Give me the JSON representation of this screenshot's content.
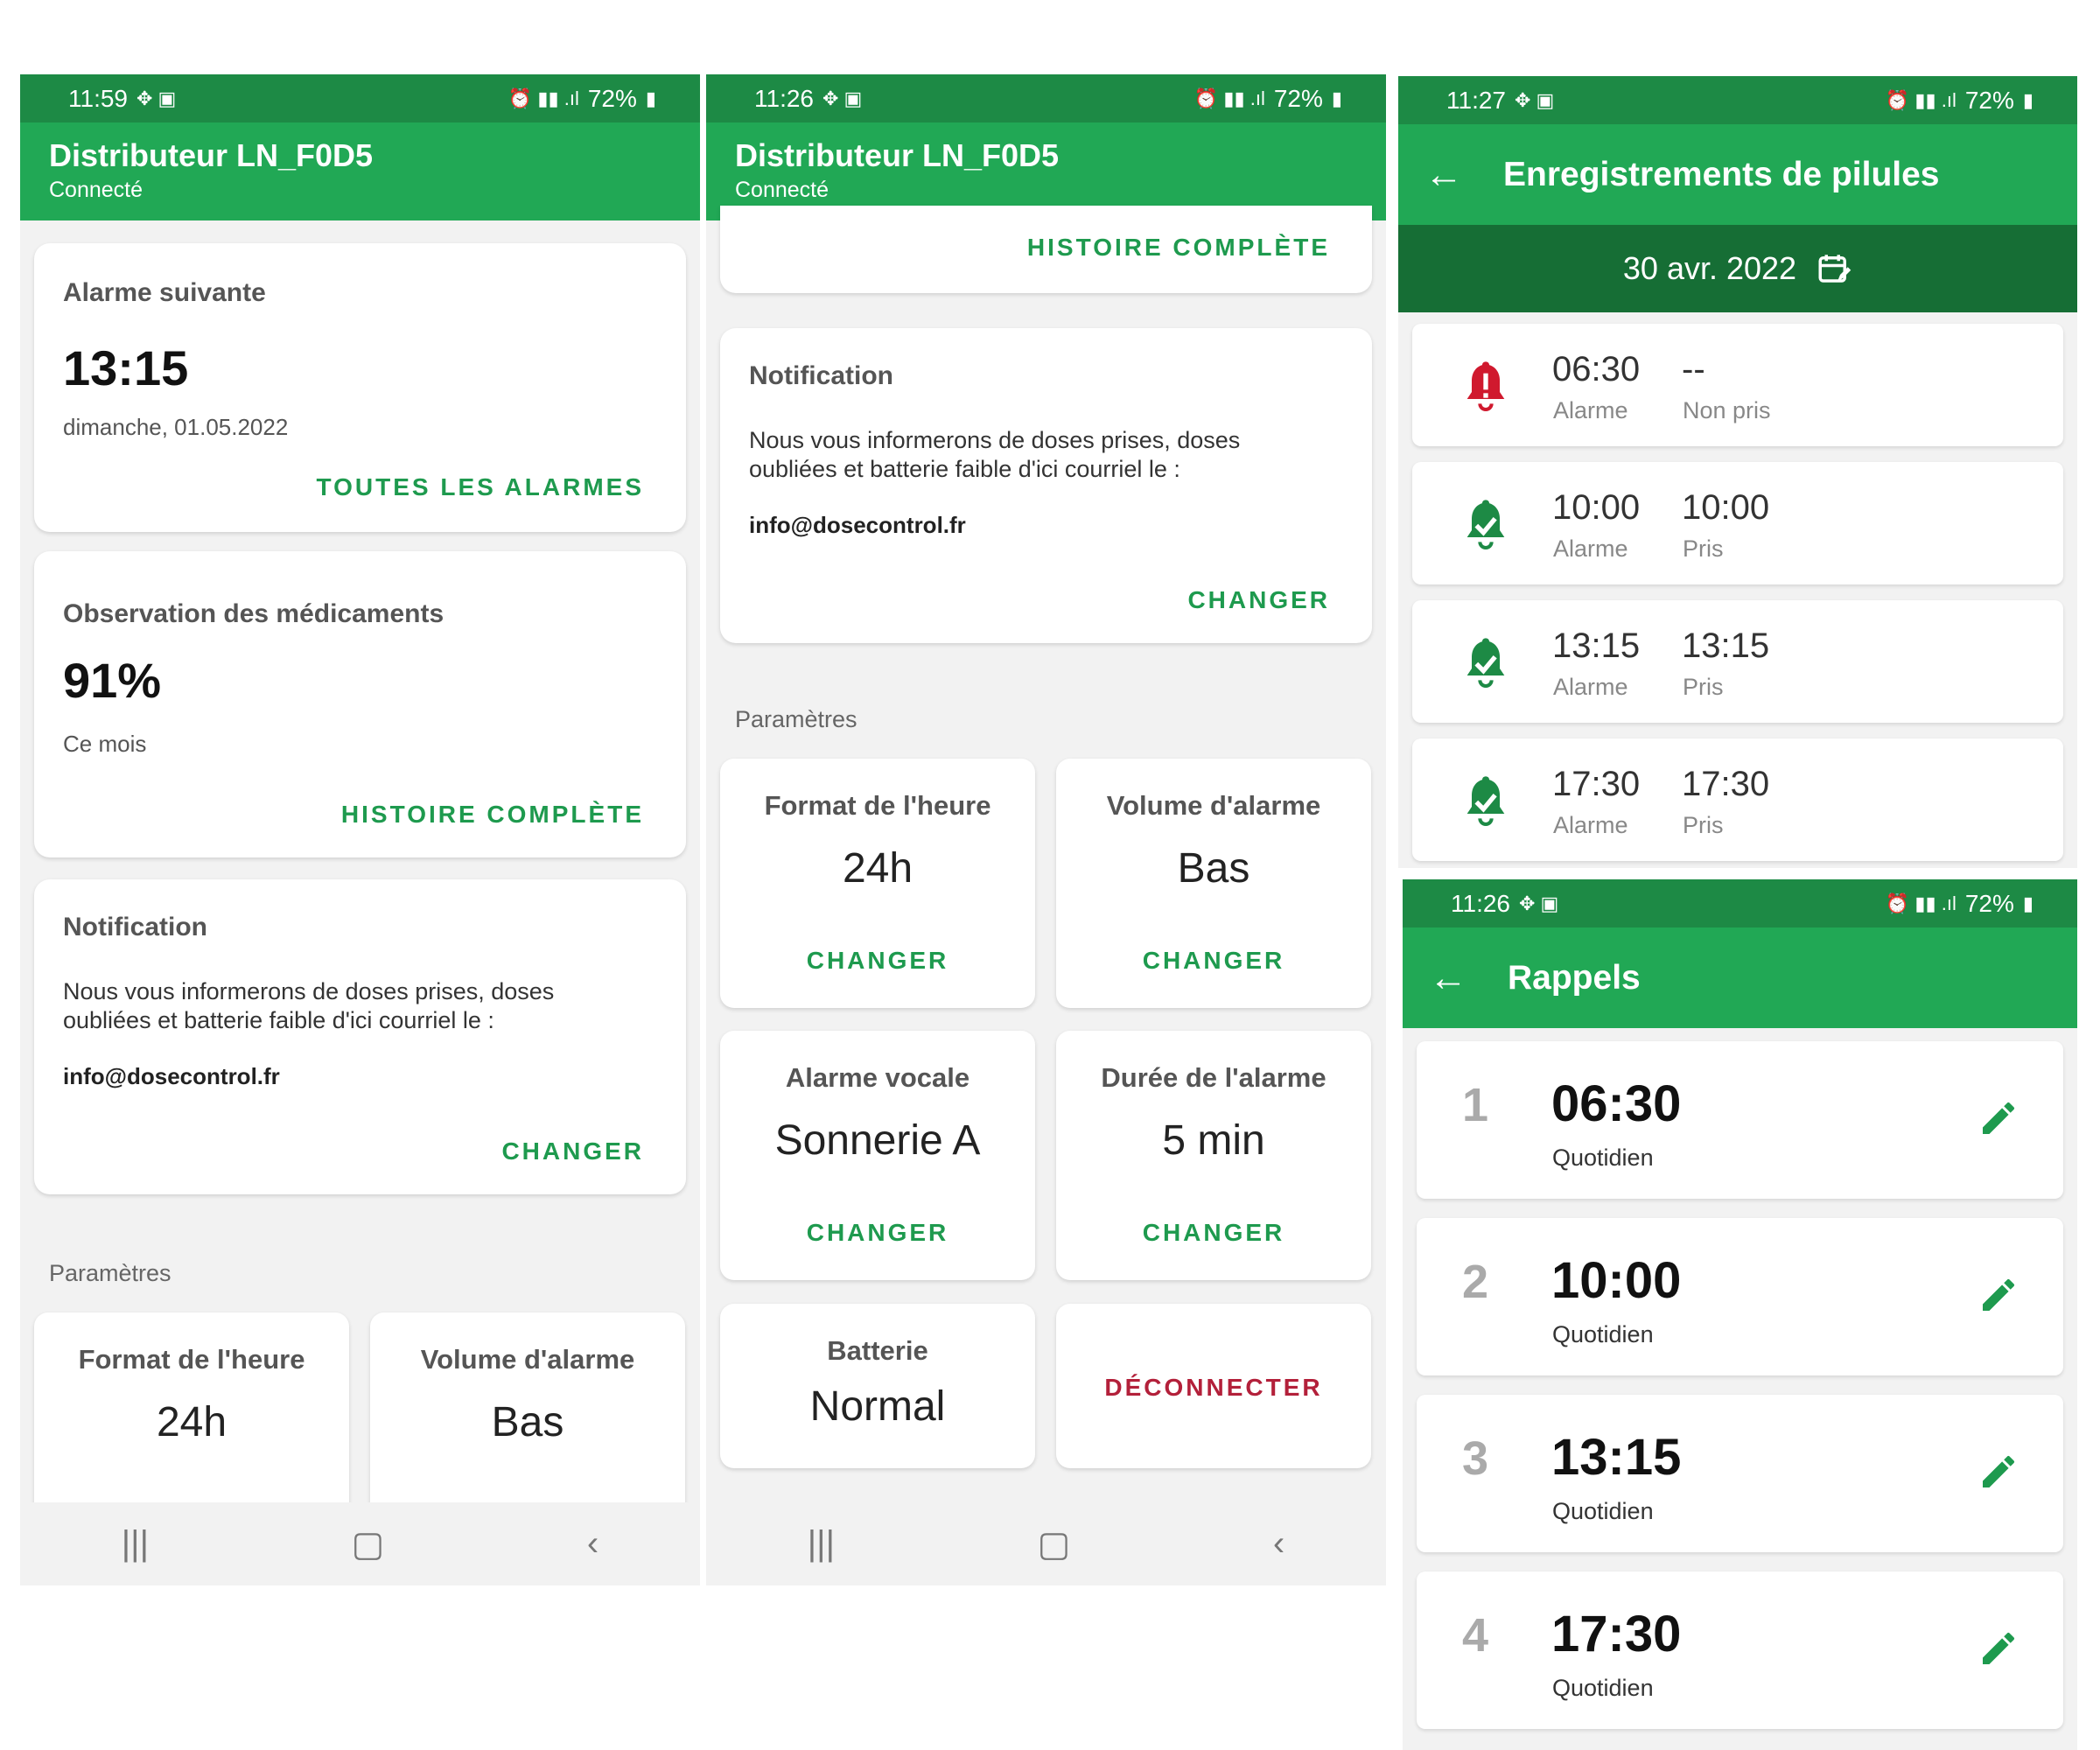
{
  "screen1": {
    "status": {
      "time": "11:59",
      "battery": "72%"
    },
    "header": {
      "title": "Distributeur LN_F0D5",
      "subtitle": "Connecté"
    },
    "next_alarm": {
      "title": "Alarme suivante",
      "time": "13:15",
      "date": "dimanche, 01.05.2022",
      "action": "TOUTES LES ALARMES"
    },
    "observation": {
      "title": "Observation des médicaments",
      "value": "91%",
      "period": "Ce mois",
      "action": "HISTOIRE COMPLÈTE"
    },
    "notification": {
      "title": "Notification",
      "text": "Nous vous informerons de doses prises, doses oubliées et batterie faible d'ici courriel le :",
      "email": "info@dosecontrol.fr",
      "action": "CHANGER"
    },
    "settings_label": "Paramètres",
    "tiles": [
      {
        "title": "Format de l'heure",
        "value": "24h"
      },
      {
        "title": "Volume d'alarme",
        "value": "Bas"
      }
    ]
  },
  "screen2": {
    "status": {
      "time": "11:26",
      "battery": "72%"
    },
    "header": {
      "title": "Distributeur LN_F0D5",
      "subtitle": "Connecté"
    },
    "history_action": "HISTOIRE COMPLÈTE",
    "notification": {
      "title": "Notification",
      "text": "Nous vous informerons de doses prises, doses oubliées et batterie faible d'ici courriel le :",
      "email": "info@dosecontrol.fr",
      "action": "CHANGER"
    },
    "settings_label": "Paramètres",
    "tiles": [
      {
        "title": "Format de l'heure",
        "value": "24h",
        "action": "CHANGER"
      },
      {
        "title": "Volume d'alarme",
        "value": "Bas",
        "action": "CHANGER"
      },
      {
        "title": "Alarme vocale",
        "value": "Sonnerie A",
        "action": "CHANGER"
      },
      {
        "title": "Durée de l'alarme",
        "value": "5 min",
        "action": "CHANGER"
      },
      {
        "title": "Batterie",
        "value": "Normal"
      }
    ],
    "disconnect": "DÉCONNECTER"
  },
  "screen3": {
    "status": {
      "time": "11:27",
      "battery": "72%"
    },
    "title": "Enregistrements de pilules",
    "date": "30 avr. 2022",
    "records": [
      {
        "alarm_time": "06:30",
        "alarm_label": "Alarme",
        "taken_time": "--",
        "taken_label": "Non pris",
        "icon": "bell-alert-icon"
      },
      {
        "alarm_time": "10:00",
        "alarm_label": "Alarme",
        "taken_time": "10:00",
        "taken_label": "Pris",
        "icon": "bell-check-icon"
      },
      {
        "alarm_time": "13:15",
        "alarm_label": "Alarme",
        "taken_time": "13:15",
        "taken_label": "Pris",
        "icon": "bell-check-icon"
      },
      {
        "alarm_time": "17:30",
        "alarm_label": "Alarme",
        "taken_time": "17:30",
        "taken_label": "Pris",
        "icon": "bell-check-icon"
      }
    ]
  },
  "screen4": {
    "status": {
      "time": "11:26",
      "battery": "72%"
    },
    "title": "Rappels",
    "reminders": [
      {
        "num": "1",
        "time": "06:30",
        "freq": "Quotidien"
      },
      {
        "num": "2",
        "time": "10:00",
        "freq": "Quotidien"
      },
      {
        "num": "3",
        "time": "13:15",
        "freq": "Quotidien"
      },
      {
        "num": "4",
        "time": "17:30",
        "freq": "Quotidien"
      }
    ]
  },
  "colors": {
    "appbar": "#21a855",
    "statusbar": "#1d8a45",
    "datebar": "#166e35",
    "accent": "#1e9a4e",
    "alert": "#d0192e",
    "danger": "#b3203a"
  }
}
